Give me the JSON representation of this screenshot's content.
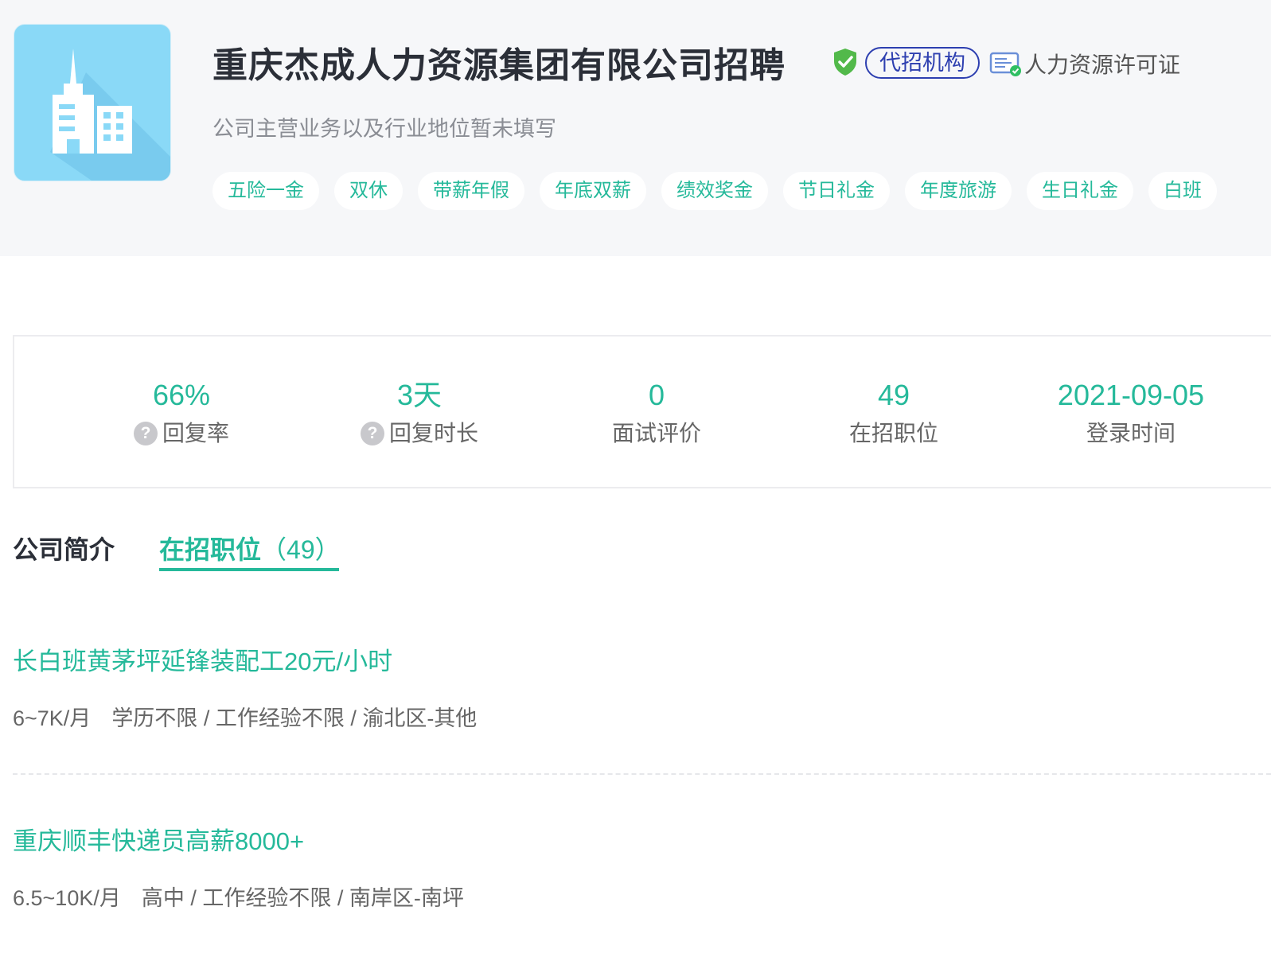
{
  "company": {
    "name": "重庆杰成人力资源集团有限公司招聘",
    "agency_badge": "代招机构",
    "license_text": "人力资源许可证",
    "description": "公司主营业务以及行业地位暂未填写",
    "benefits": [
      "五险一金",
      "双休",
      "带薪年假",
      "年底双薪",
      "绩效奖金",
      "节日礼金",
      "年度旅游",
      "生日礼金",
      "白班"
    ]
  },
  "stats": [
    {
      "value": "66%",
      "label": "回复率",
      "help": "?"
    },
    {
      "value": "3天",
      "label": "回复时长",
      "help": "?"
    },
    {
      "value": "0",
      "label": "面试评价"
    },
    {
      "value": "49",
      "label": "在招职位"
    },
    {
      "value": "2021-09-05",
      "label": "登录时间"
    }
  ],
  "tabs": {
    "intro": "公司简介",
    "jobs": "在招职位",
    "jobs_count": "（49）"
  },
  "jobs": [
    {
      "title": "长白班黄茅坪延锋装配工20元/小时",
      "salary": "6~7K/月",
      "details": "学历不限 / 工作经验不限 / 渝北区-其他"
    },
    {
      "title": "重庆顺丰快递员高薪8000+",
      "salary": "6.5~10K/月",
      "details": "高中 / 工作经验不限 / 南岸区-南坪"
    }
  ],
  "colors": {
    "accent": "#25b99a",
    "badge": "#2d3fb0",
    "header_bg": "#f6f7f9",
    "logo_bg": "#8ad9f7"
  },
  "icons": {
    "logo": "building-icon",
    "verified": "shield-check-icon",
    "license": "license-card-icon",
    "help": "question-icon"
  }
}
